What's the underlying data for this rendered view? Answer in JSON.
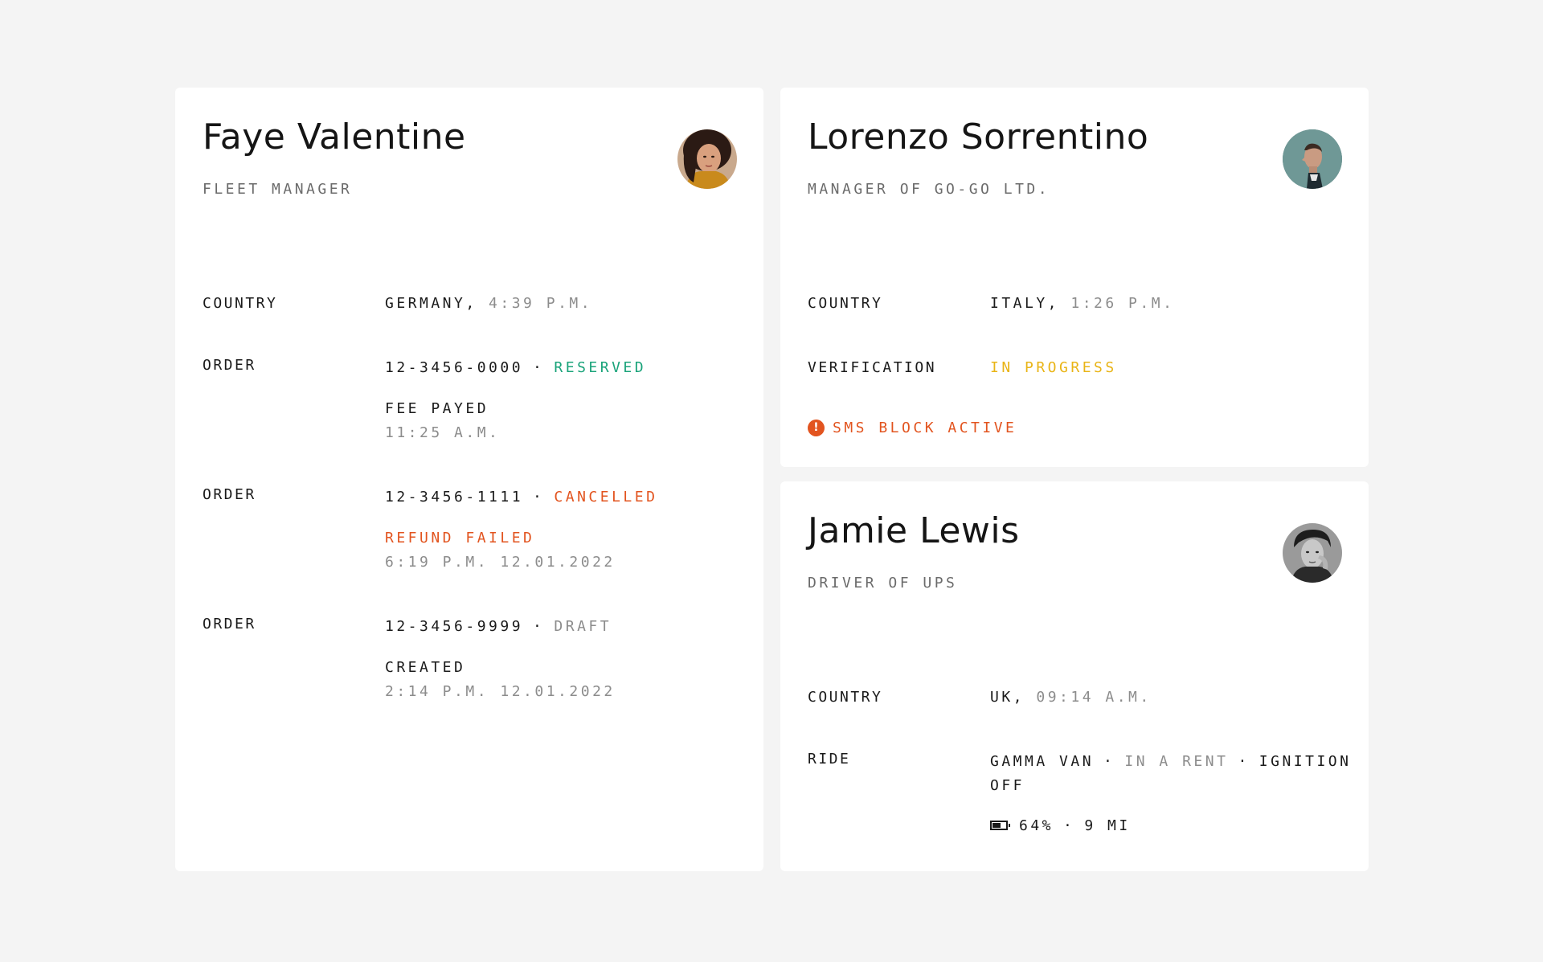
{
  "cards": {
    "faye": {
      "name": "Faye Valentine",
      "role": "FLEET MANAGER",
      "country_label": "COUNTRY",
      "country": "GERMANY,",
      "local_time": "4:39 P.M.",
      "orders": [
        {
          "label": "ORDER",
          "number": "12-3456-0000",
          "separator": "·",
          "status": "RESERVED",
          "detail": "FEE PAYED",
          "time": "11:25 A.M."
        },
        {
          "label": "ORDER",
          "number": "12-3456-1111",
          "separator": "·",
          "status": "CANCELLED",
          "detail": "REFUND FAILED",
          "time": "6:19 P.M. 12.01.2022"
        },
        {
          "label": "ORDER",
          "number": "12-3456-9999",
          "separator": "·",
          "status": "DRAFT",
          "detail": "CREATED",
          "time": "2:14 P.M. 12.01.2022"
        }
      ]
    },
    "lorenzo": {
      "name": "Lorenzo Sorrentino",
      "role": "MANAGER OF GO-GO LTD.",
      "country_label": "COUNTRY",
      "country": "ITALY,",
      "local_time": "1:26 P.M.",
      "verification_label": "VERIFICATION",
      "verification_status": "IN PROGRESS",
      "alert_icon": "!",
      "alert": "SMS BLOCK ACTIVE"
    },
    "jamie": {
      "name": "Jamie Lewis",
      "role": "DRIVER OF UPS",
      "country_label": "COUNTRY",
      "country": "UK,",
      "local_time": "09:14 A.M.",
      "ride_label": "RIDE",
      "vehicle": "GAMMA VAN",
      "separator": "·",
      "rent_status": "IN A RENT",
      "ignition_line1": "IGNITION",
      "ignition_line2": "OFF",
      "battery_percent": 64,
      "battery_text": "64%",
      "range": "9 MI"
    }
  },
  "colors": {
    "background": "#f4f4f4",
    "card": "#ffffff",
    "green": "#1aa37a",
    "red": "#e2541f",
    "yellow": "#e9b416",
    "muted": "#8c8c8c"
  }
}
